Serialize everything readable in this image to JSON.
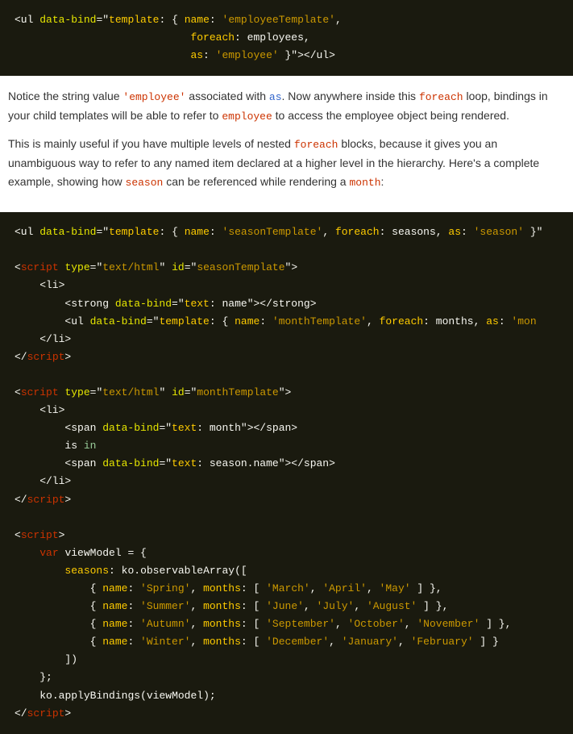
{
  "code_block_1": {
    "lines": [
      "<ul data-bind=\"template: { name: 'employeeTemplate',",
      "                            foreach: employees,",
      "                            as: 'employee' }\"></ul>"
    ]
  },
  "prose_1": {
    "text": "Notice the string value 'employee' associated with as. Now anywhere inside this foreach loop, bindings in your child templates will be able to refer to employee to access the employee object being rendered."
  },
  "prose_2": {
    "text": "This is mainly useful if you have multiple levels of nested foreach blocks, because it gives you an unambiguous way to refer to any named item declared at a higher level in the hierarchy. Here's a complete example, showing how season can be referenced while rendering a month:"
  },
  "code_block_2": {
    "raw": true
  }
}
